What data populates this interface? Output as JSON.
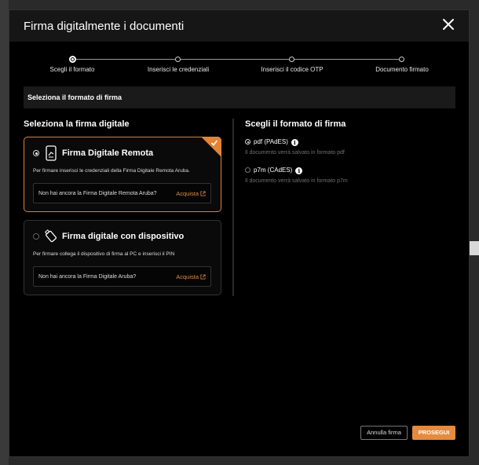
{
  "modal": {
    "title": "Firma digitalmente i documenti"
  },
  "stepper": {
    "steps": [
      {
        "label": "Scegli il formato",
        "active": true
      },
      {
        "label": "Inserisci le credenziali",
        "active": false
      },
      {
        "label": "Inserisci il codice OTP",
        "active": false
      },
      {
        "label": "Documento firmato",
        "active": false
      }
    ]
  },
  "section": {
    "title": "Seleziona il formato di firma"
  },
  "left": {
    "title": "Seleziona la firma digitale",
    "cards": [
      {
        "title": "Firma Digitale Remota",
        "desc": "Per firmare inserisci le credenziali della Firma Digitale Remota Aruba.",
        "inner_text": "Non hai ancora la Firma Digitale Remota Aruba?",
        "link": "Acquista",
        "selected": true
      },
      {
        "title": "Firma digitale con dispositivo",
        "desc": "Per firmare collega il dispositivo di firma al PC e inserisci il PIN",
        "inner_text": "Non hai ancora la Firma Digitale Aruba?",
        "link": "Acquista",
        "selected": false
      }
    ]
  },
  "right": {
    "title": "Scegli il formato di firma",
    "options": [
      {
        "label": "pdf (PAdES)",
        "desc": "Il documento verrà salvato in formato pdf",
        "checked": true
      },
      {
        "label": "p7m (CAdES)",
        "desc": "Il documento verrà salvato in formato p7m",
        "checked": false
      }
    ]
  },
  "footer": {
    "cancel_label": "Annulla firma",
    "next_label": "PROSEGUI"
  },
  "colors": {
    "accent": "#e68a3e",
    "modal_bg": "#000000",
    "backdrop": "#2a2a2a"
  }
}
